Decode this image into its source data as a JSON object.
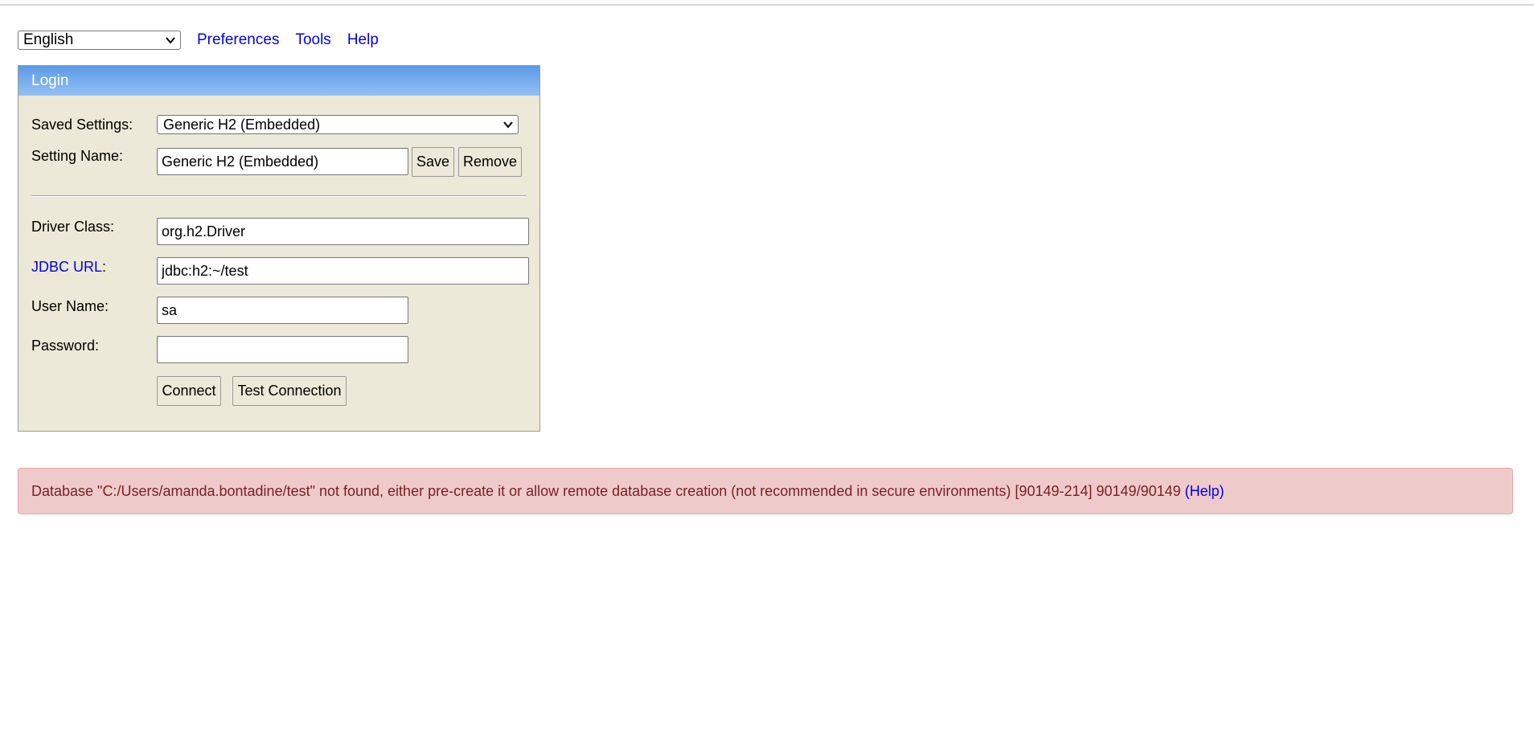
{
  "toolbar": {
    "language": "English",
    "links": [
      "Preferences",
      "Tools",
      "Help"
    ]
  },
  "login": {
    "title": "Login",
    "saved_settings_label": "Saved Settings:",
    "saved_settings_value": "Generic H2 (Embedded)",
    "setting_name_label": "Setting Name:",
    "setting_name_value": "Generic H2 (Embedded)",
    "save_label": "Save",
    "remove_label": "Remove",
    "driver_class_label": "Driver Class:",
    "driver_class_value": "org.h2.Driver",
    "jdbc_url_link": "JDBC URL",
    "jdbc_url_colon": ":",
    "jdbc_url_value": "jdbc:h2:~/test",
    "user_name_label": "User Name:",
    "user_name_value": "sa",
    "password_label": "Password:",
    "password_value": "",
    "connect_label": "Connect",
    "test_connection_label": "Test Connection"
  },
  "error": {
    "message": "Database \"C:/Users/amanda.bontadine/test\" not found, either pre-create it or allow remote database creation (not recommended in secure environments) [90149-214] 90149/90149 ",
    "help_link": "(Help)"
  },
  "colors": {
    "header_gradient_top": "#5c9ae6",
    "header_gradient_bottom": "#93c0f3",
    "panel_bg": "#ece9d8",
    "link": "#0000ee",
    "error_bg": "#efcaca",
    "error_text": "#7a1f1f"
  },
  "icons": {
    "language_select": "chevron-down-icon",
    "saved_settings_select": "chevron-down-icon"
  }
}
